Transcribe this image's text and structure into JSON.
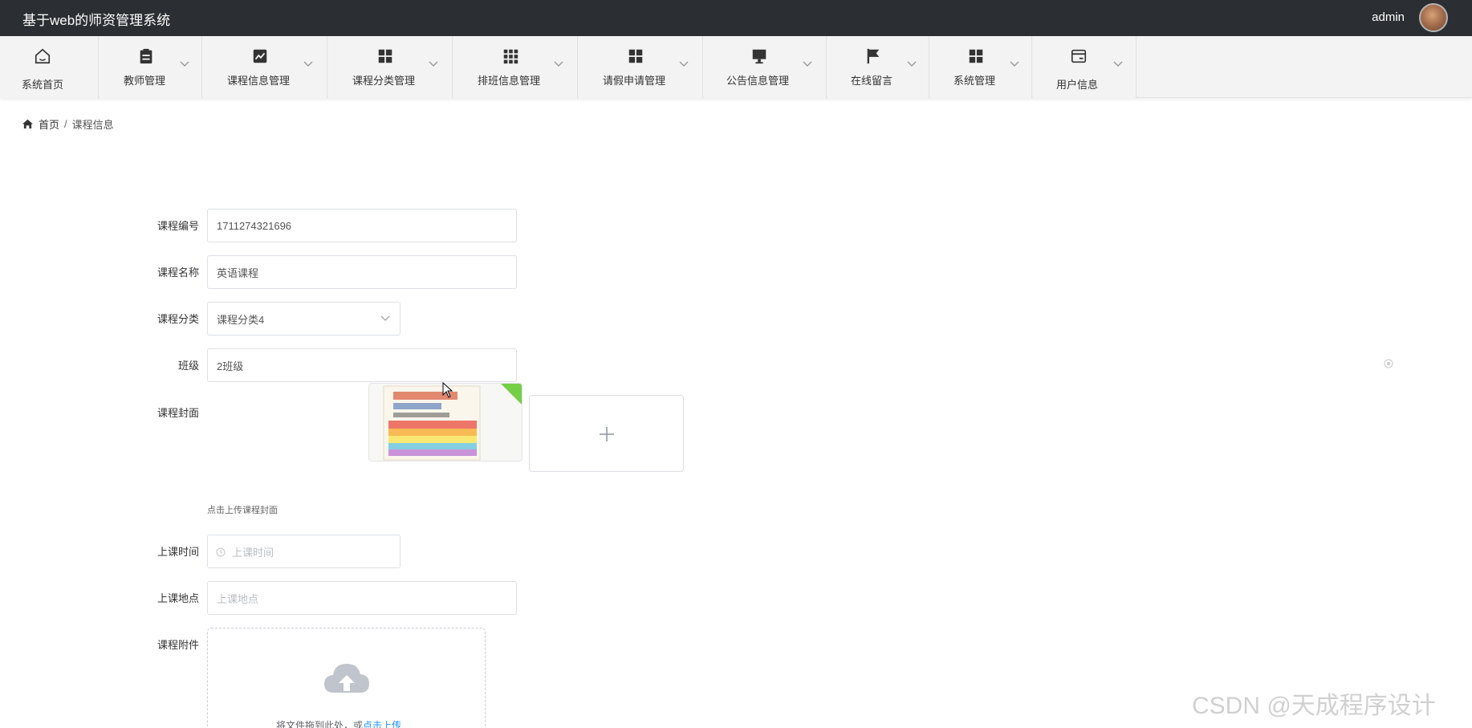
{
  "header": {
    "title": "基于web的师资管理系统",
    "username": "admin"
  },
  "nav": [
    {
      "label": "系统首页",
      "icon": "home-icon"
    },
    {
      "label": "教师管理",
      "icon": "clipboard-icon"
    },
    {
      "label": "课程信息管理",
      "icon": "line-chart-icon"
    },
    {
      "label": "课程分类管理",
      "icon": "grid-icon"
    },
    {
      "label": "排班信息管理",
      "icon": "grid-3x3-icon"
    },
    {
      "label": "请假申请管理",
      "icon": "grid-icon"
    },
    {
      "label": "公告信息管理",
      "icon": "monitor-icon"
    },
    {
      "label": "在线留言",
      "icon": "flag-icon"
    },
    {
      "label": "系统管理",
      "icon": "grid-icon"
    },
    {
      "label": "用户信息",
      "icon": "card-icon"
    }
  ],
  "breadcrumb": {
    "home": "首页",
    "separator": "/",
    "current": "课程信息"
  },
  "form": {
    "course_no": {
      "label": "课程编号",
      "value": "1711274321696"
    },
    "course_name": {
      "label": "课程名称",
      "value": "英语课程"
    },
    "category": {
      "label": "课程分类",
      "value": "课程分类4"
    },
    "class": {
      "label": "班级",
      "value": "2班级"
    },
    "cover": {
      "label": "课程封面",
      "tip": "点击上传课程封面"
    },
    "time": {
      "label": "上课时间",
      "placeholder": "上课时间"
    },
    "location": {
      "label": "上课地点",
      "placeholder": "上课地点"
    },
    "attachment": {
      "label": "课程附件",
      "text": "将文件拖到此处，或",
      "link": "点击上传"
    }
  },
  "watermark": "CSDN @天成程序设计",
  "colors": {
    "topbar": "#2b2f33",
    "navbar": "#f3f3f3",
    "link": "#1890ff",
    "success_corner": "#52c41a"
  }
}
